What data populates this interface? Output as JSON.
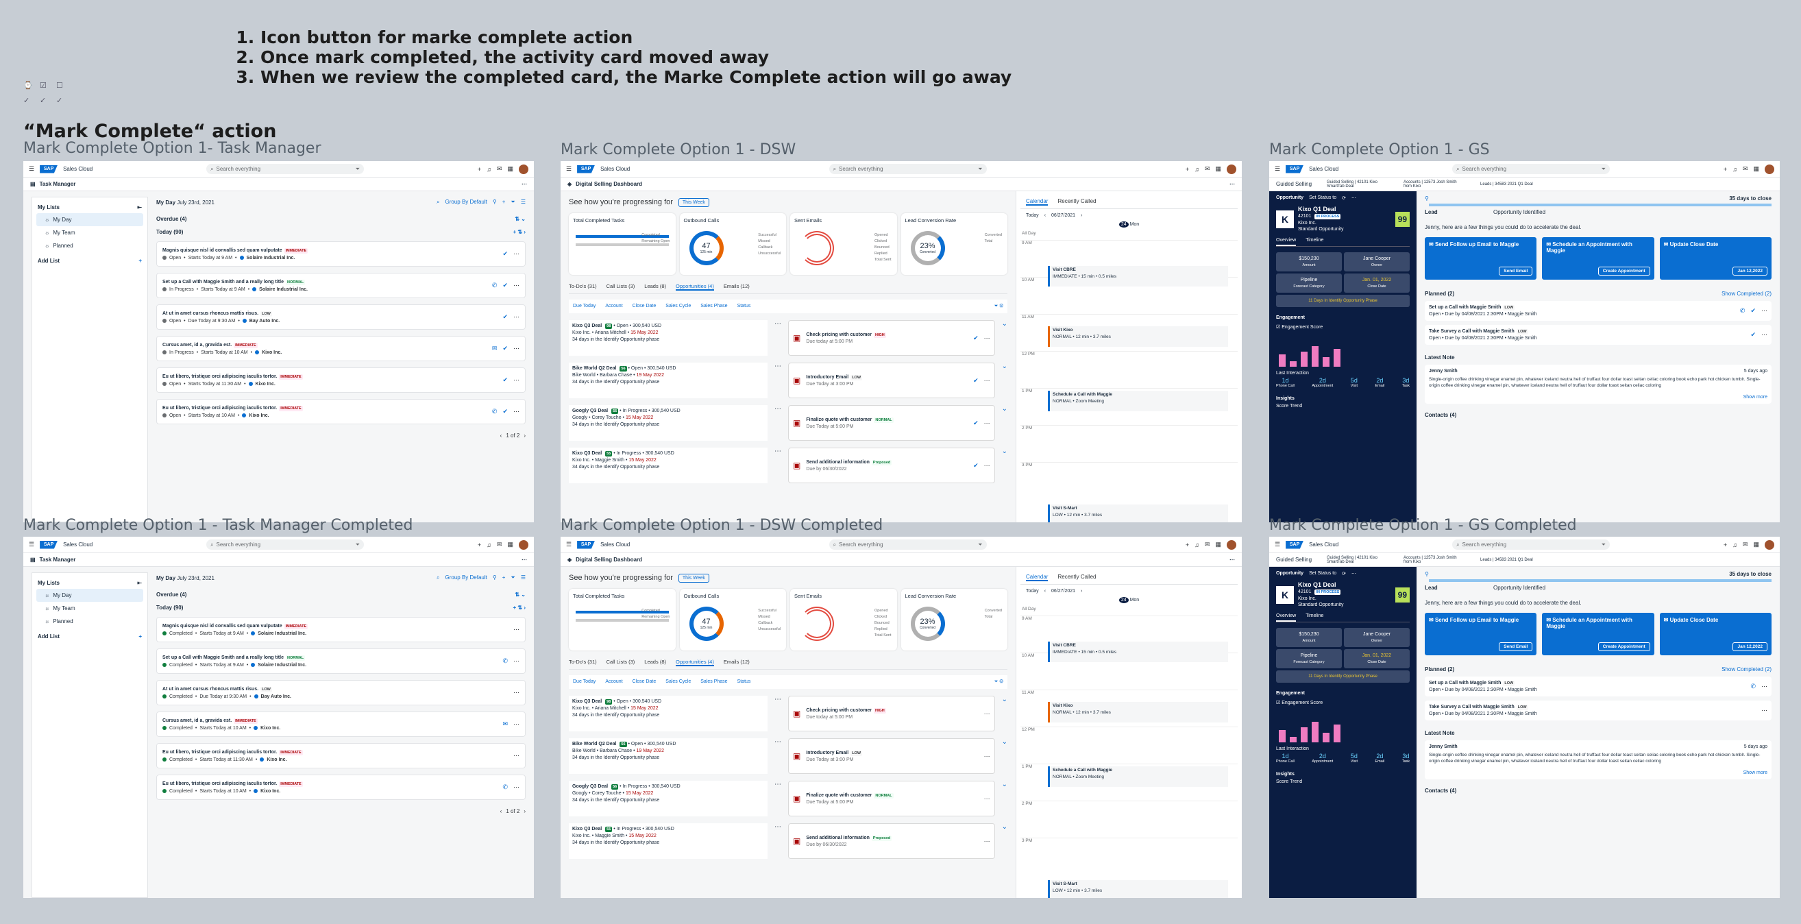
{
  "notes": [
    "Icon button for marke complete action",
    "Once mark completed, the activity card moved away",
    "When we review the completed card, the Marke Complete action will go away"
  ],
  "heading": "“Mark Complete“ action",
  "labels": {
    "tm": "Mark Complete Option 1- Task Manager",
    "dsw": "Mark Complete Option 1 - DSW",
    "gs": "Mark Complete Option 1 - GS",
    "tmc": "Mark Complete Option 1 - Task Manager Completed",
    "dswc": "Mark Complete Option 1 - DSW Completed",
    "gsc": "Mark Complete Option 1 - GS Completed"
  },
  "shell": {
    "brand": "SAP",
    "app": "Sales Cloud",
    "search": "Search everything"
  },
  "tm": {
    "title": "Task Manager",
    "my_lists": "My Lists",
    "lists": [
      "My Day",
      "My Team",
      "Planned"
    ],
    "add_list": "Add List",
    "my_day": "My Day",
    "date": "July 23rd, 2021",
    "group": "Group By Default",
    "overdue": "Overdue (4)",
    "today": "Today (90)",
    "pager": "1 of 2",
    "tasks": [
      {
        "title": "Magnis quisque nisl id convallis sed quam vulputate",
        "badge": "IMMEDIATE",
        "bcls": "b-imm",
        "status": "Open",
        "when": "Starts Today at 9 AM",
        "acct": "Solaire Industrial Inc.",
        "call": false,
        "email": false
      },
      {
        "title": "Set up a Call with Maggie Smith and a really long title",
        "badge": "NORMAL",
        "bcls": "b-nor",
        "status": "In Progress",
        "when": "Starts Today at 9 AM",
        "acct": "Solaire Industrial Inc.",
        "call": true,
        "email": false
      },
      {
        "title": "At ut in amet cursus rhoncus mattis risus.",
        "badge": "LOW",
        "bcls": "b-low",
        "status": "Open",
        "when": "Due Today at 9:30 AM",
        "acct": "Bay Auto Inc.",
        "call": false,
        "email": false
      },
      {
        "title": "Cursus amet, id a, gravida est.",
        "badge": "IMMEDIATE",
        "bcls": "b-imm",
        "status": "In Progress",
        "when": "Starts Today at 10 AM",
        "acct": "Kixo Inc.",
        "call": false,
        "email": true
      },
      {
        "title": "Eu ut libero, tristique orci adipiscing iaculis tortor.",
        "badge": "IMMEDIATE",
        "bcls": "b-imm",
        "status": "Open",
        "when": "Starts Today at 11:30 AM",
        "acct": "Kixo Inc.",
        "call": false,
        "email": false
      },
      {
        "title": "Eu ut libero, tristique orci adipiscing iaculis tortor.",
        "badge": "IMMEDIATE",
        "bcls": "b-imm",
        "status": "Open",
        "when": "Starts Today at 10 AM",
        "acct": "Kixo Inc.",
        "call": true,
        "email": false
      }
    ],
    "completed": "Completed"
  },
  "dsw": {
    "title": "Digital Selling Dashboard",
    "progress": "See how you're progressing for",
    "week": "This Week",
    "kpis": [
      {
        "title": "Total Completed Tasks",
        "value": "",
        "legend": [
          "Completed",
          "Remaining Open"
        ]
      },
      {
        "title": "Outbound Calls",
        "value": "47",
        "sub": "125 min",
        "legend": [
          "Successful",
          "Missed",
          "Callback",
          "Unsuccessful"
        ]
      },
      {
        "title": "Sent Emails",
        "value": "",
        "legend": [
          "Opened",
          "Clicked",
          "Bounced",
          "Replied",
          "Total Sent"
        ]
      },
      {
        "title": "Lead Conversion Rate",
        "value": "23%",
        "sub": "Converted",
        "legend": [
          "Converted",
          "Total"
        ]
      }
    ],
    "tabs": [
      "To-Do's (31)",
      "Call Lists (3)",
      "Leads (8)",
      "Opportunities (4)",
      "Emails (12)"
    ],
    "filters": [
      "Due Today",
      "Account",
      "Close Date",
      "Sales Cycle",
      "Sales Phase",
      "Status"
    ],
    "opps": [
      {
        "name": "Kixo Q3 Deal",
        "score": "98",
        "status": "Open",
        "amount": "300,540 USD",
        "acct": "Kixo Inc.",
        "owner": "Ariana Mitchell",
        "date": "15 May 2022",
        "phase": "34 days in the Identify Opportunity phase",
        "task": "Check pricing with customer",
        "tbadge": "HIGH",
        "tcls": "b-high",
        "due": "Due today at 5:00 PM"
      },
      {
        "name": "Bike World Q2 Deal",
        "score": "56",
        "status": "Open",
        "amount": "300,540 USD",
        "acct": "Bike World",
        "owner": "Barbara Chase",
        "date": "19 May 2022",
        "phase": "34 days in the Identify Opportunity phase",
        "task": "Introductory Email",
        "tbadge": "LOW",
        "tcls": "b-low",
        "due": "Due Today at 3:00 PM"
      },
      {
        "name": "Googly Q3 Deal",
        "score": "56",
        "status": "In Progress",
        "amount": "300,540 USD",
        "acct": "Googly",
        "owner": "Corey Touche",
        "date": "15 May 2022",
        "phase": "34 days in the Identify Opportunity phase",
        "task": "Finalize quote with customer",
        "tbadge": "NORMAL",
        "tcls": "b-nor",
        "due": "Due Today at 5:00 PM"
      },
      {
        "name": "Kixo Q3 Deal",
        "score": "55",
        "status": "In Progress",
        "amount": "300,540 USD",
        "acct": "Kixo Inc.",
        "owner": "Maggie Smith",
        "date": "15 May 2022",
        "phase": "34 days in the Identify Opportunity phase",
        "task": "Send additional information",
        "tbadge": "Proposed",
        "tcls": "b-nor",
        "due": "Due by 06/30/2022"
      }
    ],
    "cal_tabs": [
      "Calendar",
      "Recently Called"
    ],
    "today": "Today",
    "date": "06/27/2021",
    "day": "24",
    "dow": "Mon",
    "allday": "All Day",
    "times": [
      "9 AM",
      "10 AM",
      "11 AM",
      "12 PM",
      "1 PM",
      "2 PM",
      "3 PM"
    ],
    "events": [
      {
        "title": "Visit CBRE",
        "meta": "IMMEDIATE",
        "extra": "15 min • 0.5 miles"
      },
      {
        "title": "Visit Kixo",
        "meta": "NORMAL",
        "extra": "12 min • 3.7 miles"
      },
      {
        "title": "Schedule a Call with Maggie",
        "meta": "NORMAL",
        "extra": "Zoom Meeting"
      },
      {
        "title": "Visit S-Mart",
        "meta": "LOW",
        "extra": "12 min • 3.7 miles"
      }
    ]
  },
  "gs": {
    "guided": "Guided Selling",
    "crumbs": [
      "Guided Selling | 42101 Kixo SmartTab Deal",
      "Accounts | 12573 Josh Smith from Kixo",
      "Leads | 34583 2021 Q1 Deal"
    ],
    "opp": "Opportunity",
    "set_status": "Set Status to",
    "deal": "Kixo Q1 Deal",
    "id": "42101",
    "in_process": "IN PROCESS",
    "company": "Kixo Inc.",
    "type": "Standard Opportunity",
    "score": "99",
    "tabs": [
      "Overview",
      "Timeline"
    ],
    "amount": "$150,230",
    "amount_l": "Amount",
    "owner": "Jane Cooper",
    "owner_l": "Owner",
    "pipeline": "Pipeline",
    "pipeline_l": "Forecast Category",
    "close": "Jan. 01, 2022",
    "close_l": "Close Date",
    "phase": "11 Days In Identify Opportunity Phase",
    "engagement": "Engagement",
    "eng_score": "Engagement Score",
    "last": "Last Interaction",
    "inter": [
      {
        "v": "1d",
        "l": "Phone Call"
      },
      {
        "v": "2d",
        "l": "Appointment"
      },
      {
        "v": "5d",
        "l": "Visit"
      },
      {
        "v": "2d",
        "l": "Email"
      },
      {
        "v": "3d",
        "l": "Task"
      }
    ],
    "insights": "Insights",
    "trend": "Score Trend",
    "stage_lead": "Lead",
    "stage_opp": "Opportunity Identified",
    "days": "35 days to close",
    "prompt": "Jenny, here are a few things you could do to accelerate the deal.",
    "sugg": [
      {
        "title": "Send Follow up Email to Maggie",
        "btn": "Send Email"
      },
      {
        "title": "Schedule an Appointment with Maggie",
        "btn": "Create Appointment"
      },
      {
        "title": "Update Close Date",
        "btn": "Jan 12,2022"
      }
    ],
    "planned": "Planned (2)",
    "show_completed": "Show Completed (2)",
    "ptasks": [
      {
        "title": "Set up a Call with Maggie Smith",
        "badge": "LOW",
        "meta": "Open • Due by 04/08/2021 2:30PM • Maggie Smith"
      },
      {
        "title": "Take Survey a Call with Maggie Smith",
        "badge": "LOW",
        "meta": "Open • Due by 04/08/2021 2:30PM • Maggie Smith"
      }
    ],
    "latest": "Latest Note",
    "author": "Jenny Smith",
    "ago": "5 days ago",
    "note": "Single-origin coffee drinking vinegar enamel pin, whatever iceland neutra hell of truffaut four dollar toast seitan celiac coloring book echo park hot chicken tumblr. Single-origin coffee drinking vinegar enamel pin, whatever iceland neutra hell of truffaut four dollar toast seitan celiac coloring",
    "more": "Show more",
    "contacts": "Contacts (4)"
  },
  "colors": {
    "brand": "#0a6ed1",
    "dark": "#0b1d42"
  }
}
